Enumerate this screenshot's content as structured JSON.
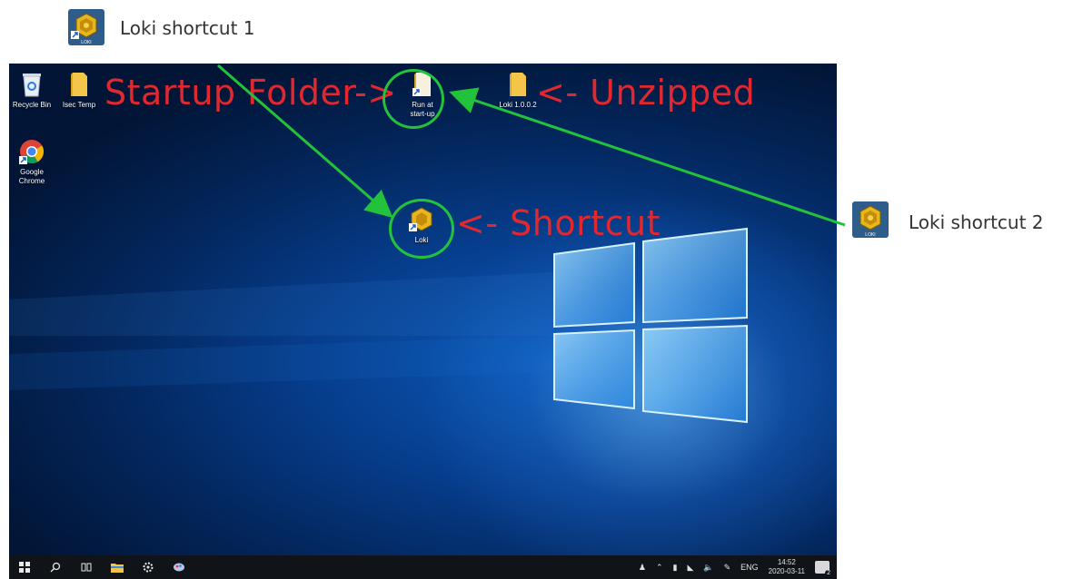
{
  "callouts": {
    "shortcut1": {
      "label": "Loki shortcut 1",
      "icon": "loki-icon",
      "badge": "LOKI"
    },
    "shortcut2": {
      "label": "Loki shortcut 2",
      "icon": "loki-icon",
      "badge": "LOKI"
    }
  },
  "desktop_icons": [
    {
      "label": "Recycle Bin",
      "icon": "recycle-bin-icon"
    },
    {
      "label": "Isec Temp",
      "icon": "folder-icon"
    },
    {
      "label": "Google Chrome",
      "icon": "chrome-icon"
    },
    {
      "label": "Run at start-up",
      "icon": "folder-shortcut-icon"
    },
    {
      "label": "Loki 1.0.0.2",
      "icon": "folder-icon"
    },
    {
      "label": "Loki",
      "icon": "loki-icon"
    }
  ],
  "annotations": {
    "startup": "Startup Folder->",
    "unzipped": "<- Unzipped",
    "shortcut": "<- Shortcut"
  },
  "taskbar": {
    "buttons": [
      "start-icon",
      "search-icon",
      "task-view-icon",
      "file-explorer-icon",
      "settings-icon",
      "app-icon"
    ],
    "tray": {
      "language": "ENG",
      "time": "14:52",
      "date": "2020-03-11",
      "notifications": "2"
    }
  },
  "colors": {
    "annotation_red": "#e0282e",
    "annotation_green": "#22c33a",
    "taskbar": "#101418"
  }
}
